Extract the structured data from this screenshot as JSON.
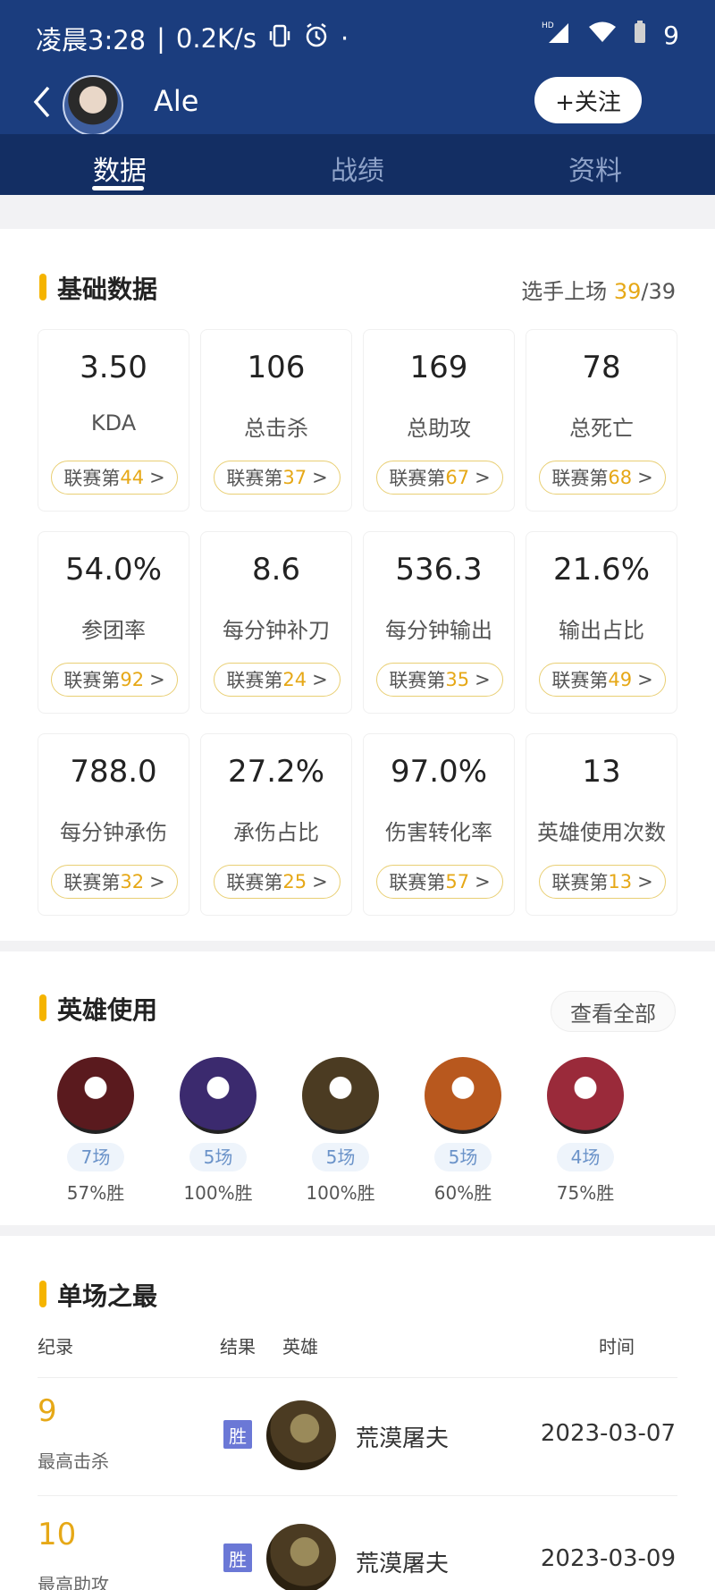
{
  "status_bar": {
    "time": "凌晨3:28",
    "net_speed": "0.2K/s",
    "battery": "9",
    "icons": [
      "vibrate-icon",
      "alarm-icon",
      "hd-signal-icon",
      "wifi-icon",
      "battery-icon"
    ]
  },
  "header": {
    "player_name": "Ale",
    "follow_label": "+关注",
    "tabs": [
      {
        "label": "数据"
      },
      {
        "label": "战绩"
      },
      {
        "label": "资料"
      }
    ]
  },
  "basic": {
    "title": "基础数据",
    "appear_label": "选手上场",
    "appear_played": "39",
    "appear_total": "/39",
    "rank_prefix": "联赛第",
    "rank_suffix": ">",
    "stats": [
      {
        "value": "3.50",
        "label": "KDA",
        "rank": "44"
      },
      {
        "value": "106",
        "label": "总击杀",
        "rank": "37"
      },
      {
        "value": "169",
        "label": "总助攻",
        "rank": "67"
      },
      {
        "value": "78",
        "label": "总死亡",
        "rank": "68"
      },
      {
        "value": "54.0%",
        "label": "参团率",
        "rank": "92"
      },
      {
        "value": "8.6",
        "label": "每分钟补刀",
        "rank": "24"
      },
      {
        "value": "536.3",
        "label": "每分钟输出",
        "rank": "35"
      },
      {
        "value": "21.6%",
        "label": "输出占比",
        "rank": "49"
      },
      {
        "value": "788.0",
        "label": "每分钟承伤",
        "rank": "32"
      },
      {
        "value": "27.2%",
        "label": "承伤占比",
        "rank": "25"
      },
      {
        "value": "97.0%",
        "label": "伤害转化率",
        "rank": "57"
      },
      {
        "value": "13",
        "label": "英雄使用次数",
        "rank": "13"
      }
    ]
  },
  "heroes": {
    "title": "英雄使用",
    "view_all": "查看全部",
    "items": [
      {
        "games": "7场",
        "winrate": "57%胜",
        "color": "#5a1a1e"
      },
      {
        "games": "5场",
        "winrate": "100%胜",
        "color": "#3b2a6e"
      },
      {
        "games": "5场",
        "winrate": "100%胜",
        "color": "#4b3b22"
      },
      {
        "games": "5场",
        "winrate": "60%胜",
        "color": "#b8581e"
      },
      {
        "games": "4场",
        "winrate": "75%胜",
        "color": "#9a2a3a"
      }
    ]
  },
  "records": {
    "title": "单场之最",
    "headers": {
      "record": "纪录",
      "result": "结果",
      "hero": "英雄",
      "time": "时间"
    },
    "rows": [
      {
        "value": "9",
        "label": "最高击杀",
        "result": "胜",
        "hero": "荒漠屠夫",
        "date": "2023-03-07"
      },
      {
        "value": "10",
        "label": "最高助攻",
        "result": "胜",
        "hero": "荒漠屠夫",
        "date": "2023-03-09"
      }
    ]
  },
  "colors": {
    "header_bg": "#1b3d7e",
    "accent": "#f5b400",
    "rank_text": "#e6a817",
    "win_badge": "#6b78d6"
  }
}
